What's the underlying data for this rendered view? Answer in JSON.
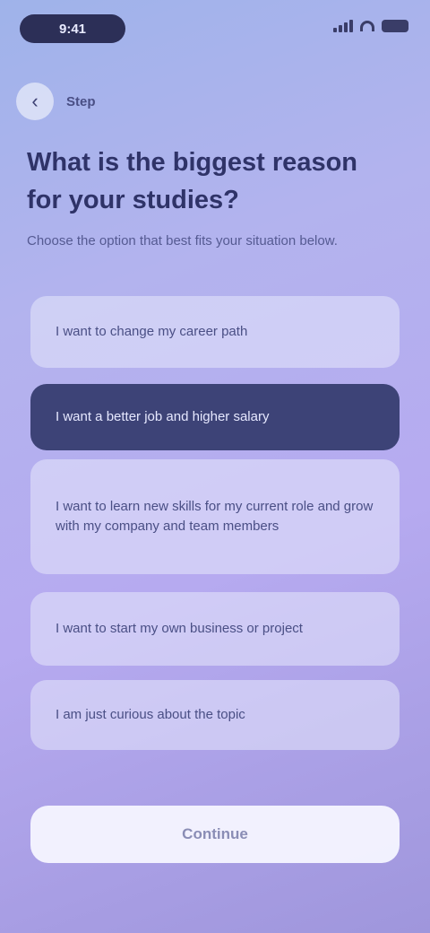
{
  "status_bar": {
    "time": "9:41"
  },
  "header": {
    "back_icon": "back-arrow-icon",
    "step_label": "Step"
  },
  "question": {
    "title": "What is the biggest reason for your studies?",
    "subtitle": "Choose the option that best fits your situation below."
  },
  "options": [
    {
      "label": "I want to change my career path",
      "selected": false
    },
    {
      "label": "I want a better job and higher salary",
      "selected": true
    },
    {
      "label": "I want to learn new skills for my current role and grow with my company and team members",
      "selected": false
    },
    {
      "label": "I want to start my own business or project",
      "selected": false
    },
    {
      "label": "I am just curious about the topic",
      "selected": false
    }
  ],
  "cta": {
    "label": "Continue"
  },
  "colors": {
    "selected_bg": "#3d4377",
    "option_bg": "#e6e8fc",
    "cta_bg": "#f6f6ff"
  }
}
